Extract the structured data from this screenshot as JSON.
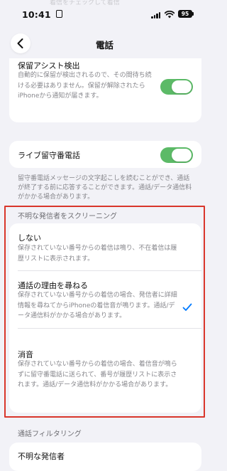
{
  "status": {
    "time": "10:41",
    "battery": "95",
    "faded_banner": "着信をチェックして着信"
  },
  "nav": {
    "title": "電話"
  },
  "hold_assist": {
    "title": "保留アシスト検出",
    "description": "自動的に保留が検出されるので、その間待ち続ける必要はありません。保留が解除されたらiPhoneから通知が届きます。",
    "enabled": true
  },
  "live_voicemail": {
    "title": "ライブ留守番電話",
    "enabled": true,
    "footnote": "留守番電話メッセージの文字起こしを読むことができ、通話が終了する前に応答することができます。通話/データ通信料がかかる場合があります。"
  },
  "screening": {
    "header": "不明な発信者をスクリーニング",
    "options": [
      {
        "title": "しない",
        "description": "保存されていない番号からの着信は鳴り、不在着信は履歴リストに表示されます。",
        "selected": false
      },
      {
        "title": "通話の理由を尋ねる",
        "description": "保存されていない番号からの着信の場合、発信者に詳細情報を尋ねてからiPhoneの着信音が鳴ります。通話/データ通信料がかかる場合があります。",
        "selected": true
      },
      {
        "title": "消音",
        "description": "保存されていない番号からの着信の場合、着信音が鳴らずに留守番電話に送られて、番号が履歴リストに表示されます。通話/データ通信料がかかる場合があります。",
        "selected": false
      }
    ]
  },
  "filtering": {
    "header": "通話フィルタリング",
    "partial_row": "不明な発信者"
  },
  "colors": {
    "accent": "#007aff",
    "toggle_on": "#5cba67",
    "highlight": "#d9362b",
    "background": "#f2f2f7"
  }
}
